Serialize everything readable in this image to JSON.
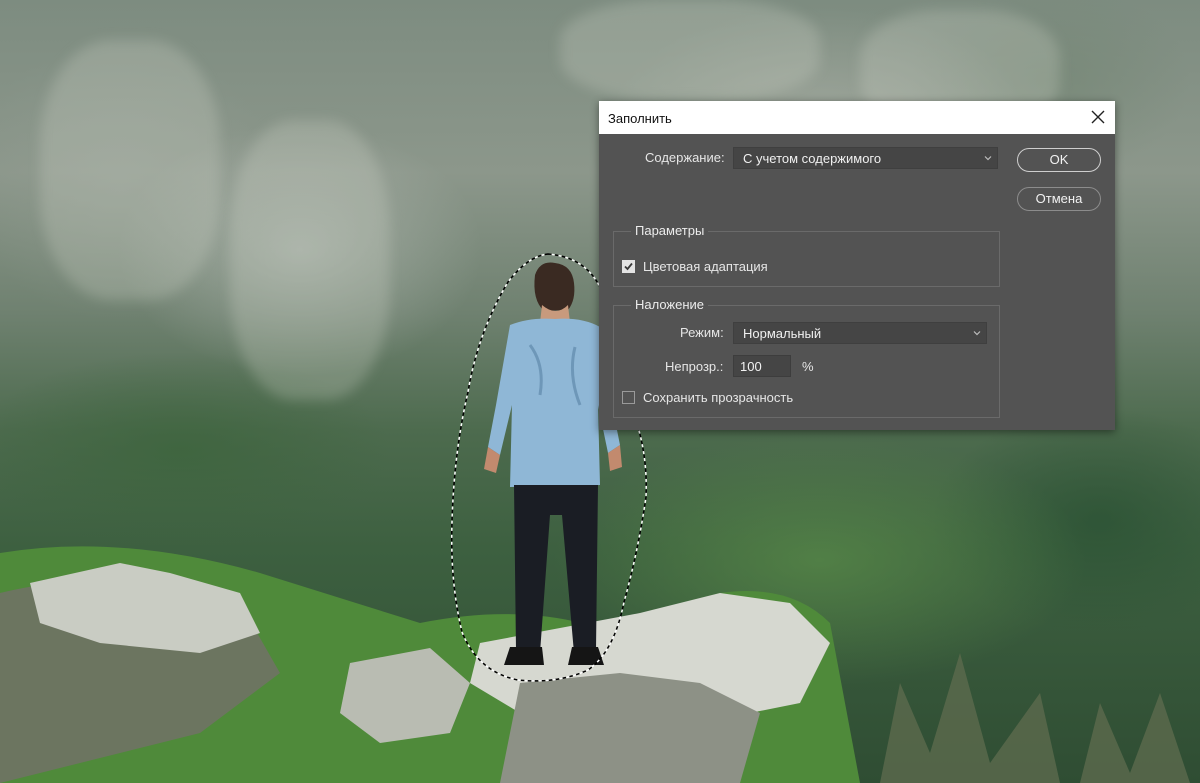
{
  "dialog": {
    "title": "Заполнить",
    "content_label": "Содержание:",
    "content_value": "С учетом содержимого",
    "ok_label": "OK",
    "cancel_label": "Отмена",
    "options": {
      "title": "Параметры",
      "color_adaptation_label": "Цветовая адаптация",
      "color_adaptation_checked": true
    },
    "blending": {
      "title": "Наложение",
      "mode_label": "Режим:",
      "mode_value": "Нормальный",
      "opacity_label": "Непрозр.:",
      "opacity_value": "100",
      "opacity_unit": "%",
      "preserve_transparency_label": "Сохранить прозрачность",
      "preserve_transparency_checked": false
    }
  },
  "icons": {
    "close": "close-icon",
    "dropdown": "chevron-down-icon",
    "check": "checkmark-icon"
  },
  "colors": {
    "dialog_bg": "#535353",
    "titlebar_bg": "#ffffff",
    "selection_outline": "#000000"
  }
}
